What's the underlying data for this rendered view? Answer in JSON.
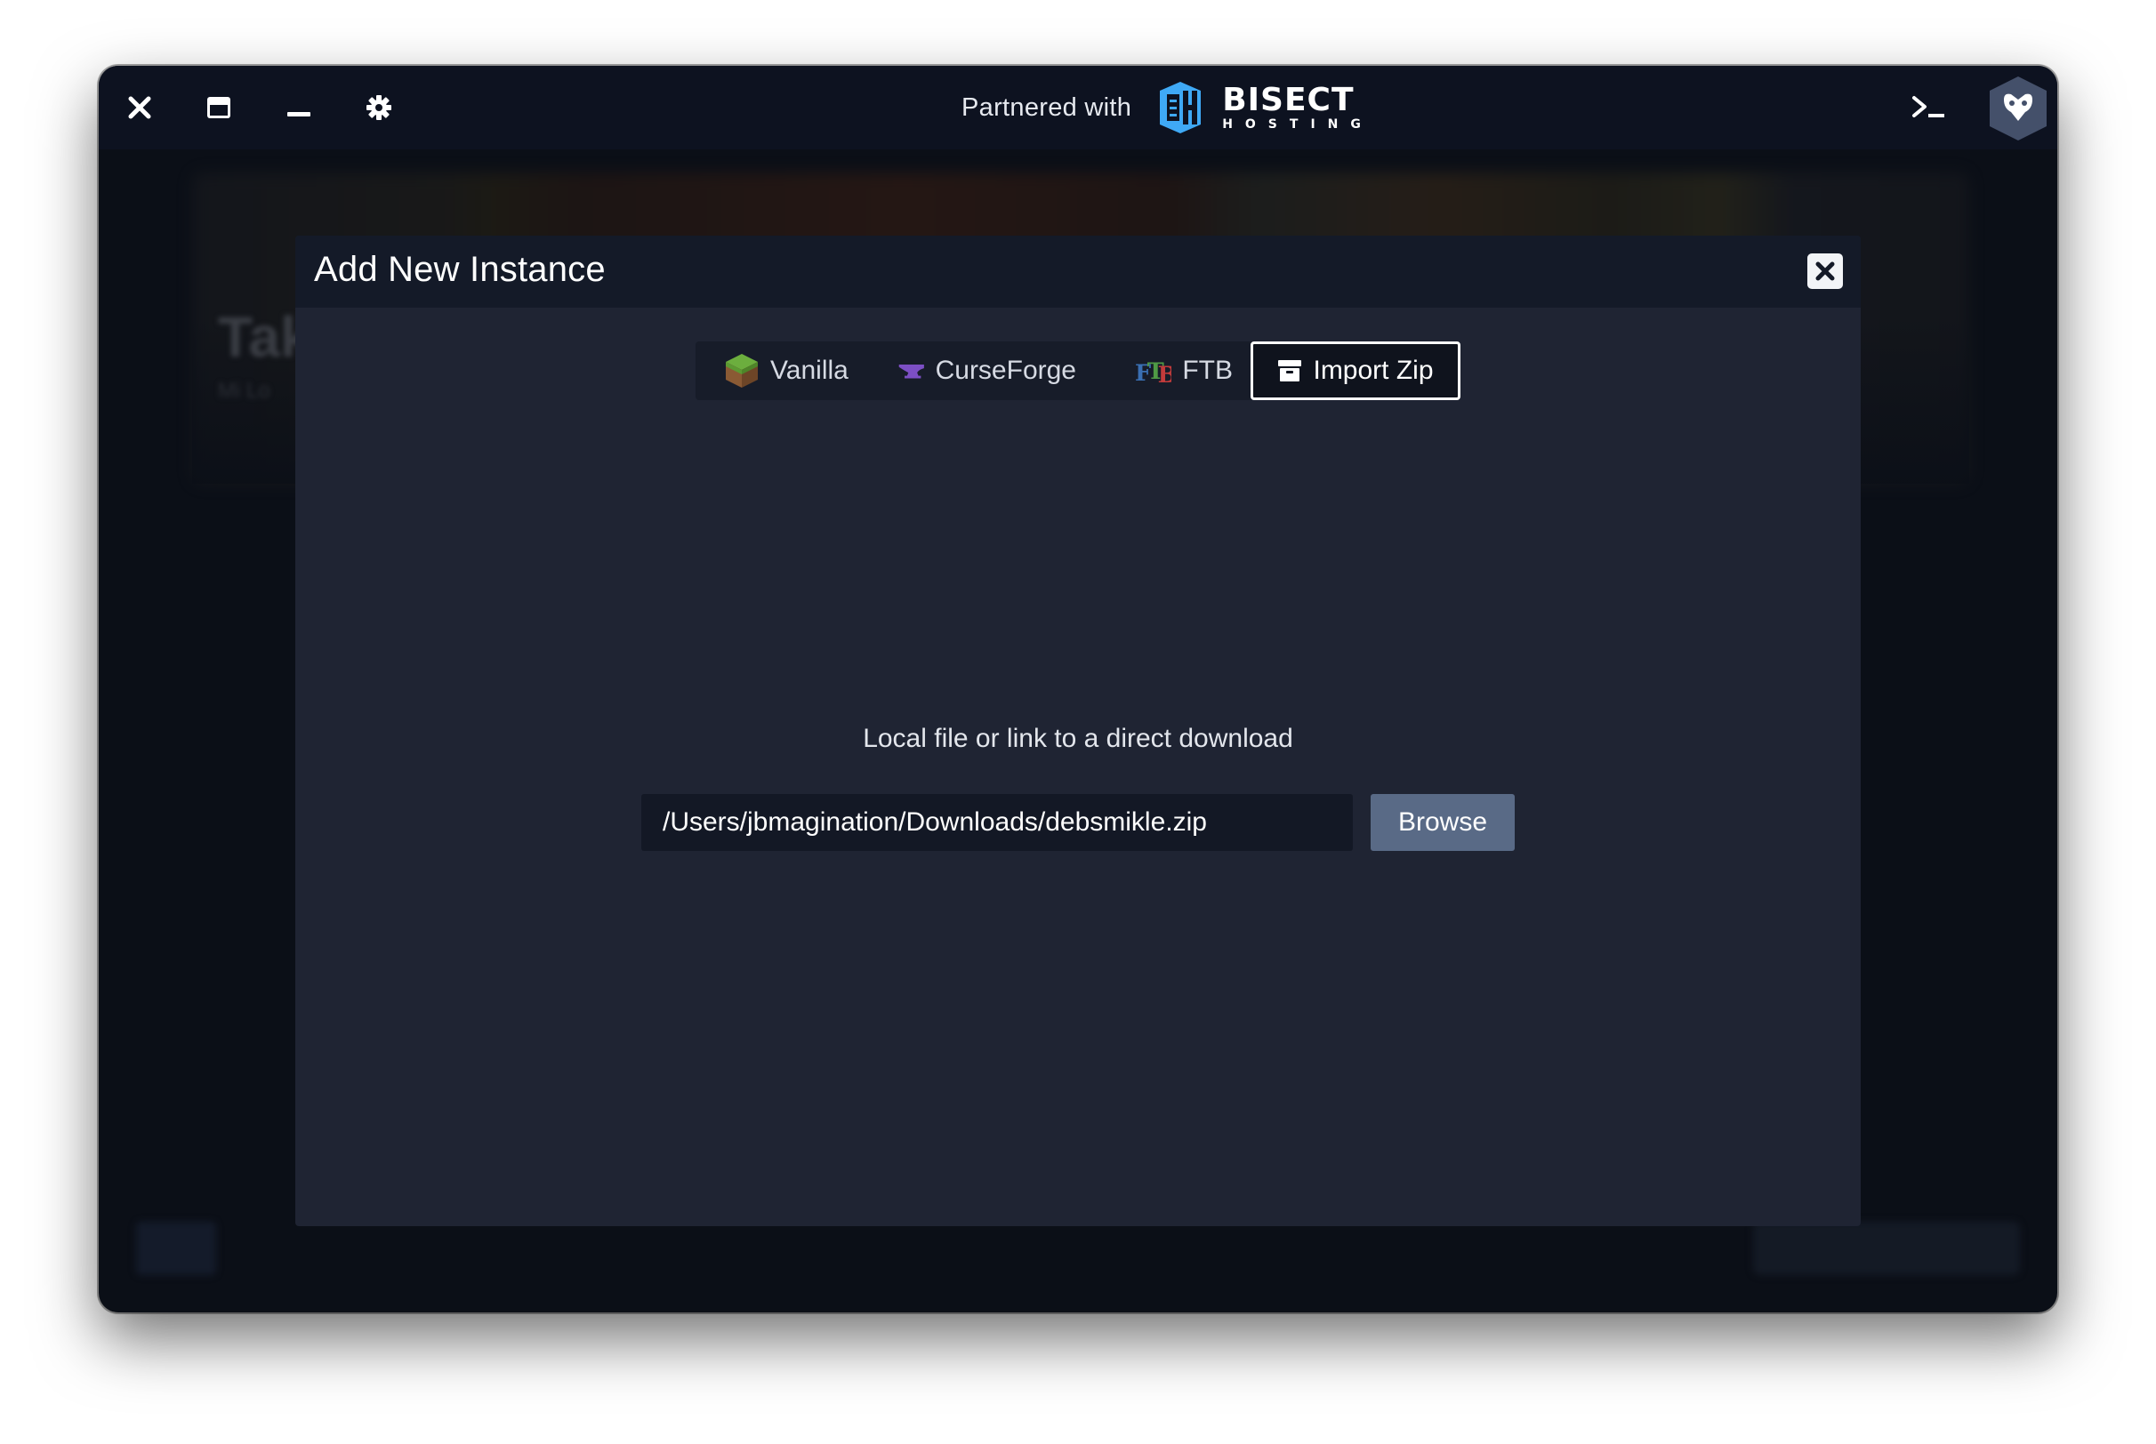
{
  "titlebar": {
    "partner_text": "Partnered with",
    "partner_logo_main": "BISECT",
    "partner_logo_sub": "HOSTING",
    "icons": {
      "close": "close-icon",
      "maximize": "window-icon",
      "minimize": "minimize-icon",
      "settings": "gear-icon",
      "terminal": "terminal-icon",
      "profile": "user-avatar"
    }
  },
  "background": {
    "title": "Tak",
    "subtitle": "Mi Lo"
  },
  "modal": {
    "title": "Add New Instance",
    "tabs": [
      {
        "label": "Vanilla",
        "icon": "grass-block-icon",
        "active": false
      },
      {
        "label": "CurseForge",
        "icon": "anvil-icon",
        "active": false
      },
      {
        "label": "FTB",
        "icon": "ftb-logo-icon",
        "active": false
      },
      {
        "label": "Import Zip",
        "icon": "archive-icon",
        "active": true
      }
    ],
    "prompt": "Local file or link to a direct download",
    "path_value": "/Users/jbmagination/Downloads/debsmikle.zip",
    "browse_label": "Browse"
  },
  "colors": {
    "window_bg": "#0b0f17",
    "modal_bg": "#1f2433",
    "modal_header_bg": "#141a28",
    "browse_bg": "#596a86",
    "bisect_blue": "#3fa9f5"
  }
}
